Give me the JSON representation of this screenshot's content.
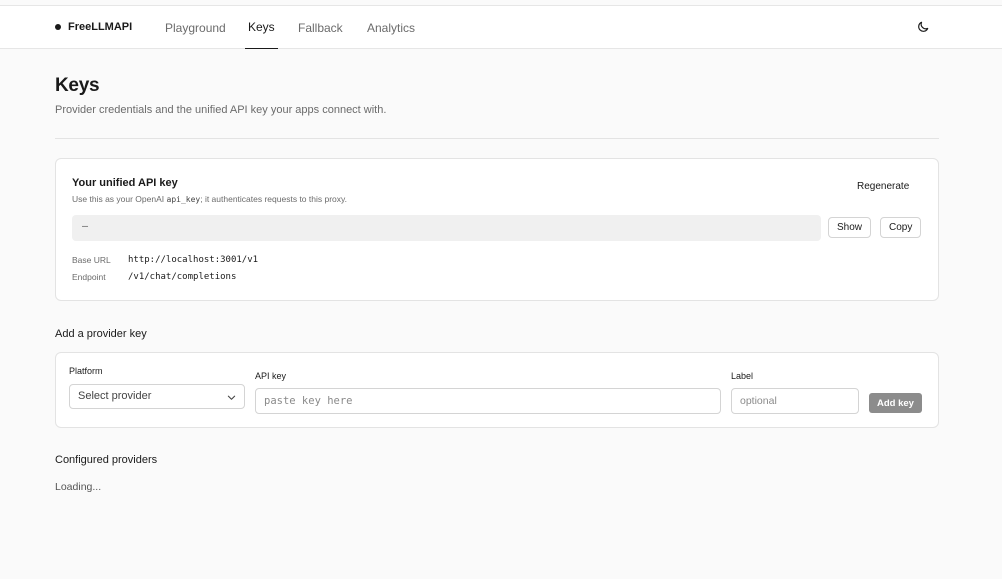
{
  "app": {
    "name": "FreeLLMAPI"
  },
  "nav": {
    "tabs": [
      {
        "label": "Playground",
        "active": false
      },
      {
        "label": "Keys",
        "active": true
      },
      {
        "label": "Fallback",
        "active": false
      },
      {
        "label": "Analytics",
        "active": false
      }
    ],
    "theme_toggle_icon": "moon-icon"
  },
  "page": {
    "title": "Keys",
    "subtitle": "Provider credentials and the unified API key your apps connect with."
  },
  "unified_key": {
    "title": "Your unified API key",
    "description_pre": "Use this as your OpenAI ",
    "description_code": "api_key",
    "description_post": "; it authenticates requests to this proxy.",
    "regenerate_label": "Regenerate",
    "key_value": "–",
    "show_label": "Show",
    "copy_label": "Copy",
    "base_url_label": "Base URL",
    "base_url_value": "http://localhost:3001/v1",
    "endpoint_label": "Endpoint",
    "endpoint_value": "/v1/chat/completions"
  },
  "add_provider": {
    "section_title": "Add a provider key",
    "platform_label": "Platform",
    "platform_selected": "Select provider",
    "api_key_label": "API key",
    "api_key_placeholder": "paste key here",
    "label_label": "Label",
    "label_placeholder": "optional",
    "add_button_label": "Add key"
  },
  "configured": {
    "section_title": "Configured providers",
    "status_text": "Loading..."
  },
  "colors": {
    "background": "#fafafa",
    "card": "#ffffff",
    "border": "#e3e3e3",
    "text": "#1a1a1a",
    "muted": "#6b6b6b",
    "button_disabled": "#8c8c8c"
  }
}
